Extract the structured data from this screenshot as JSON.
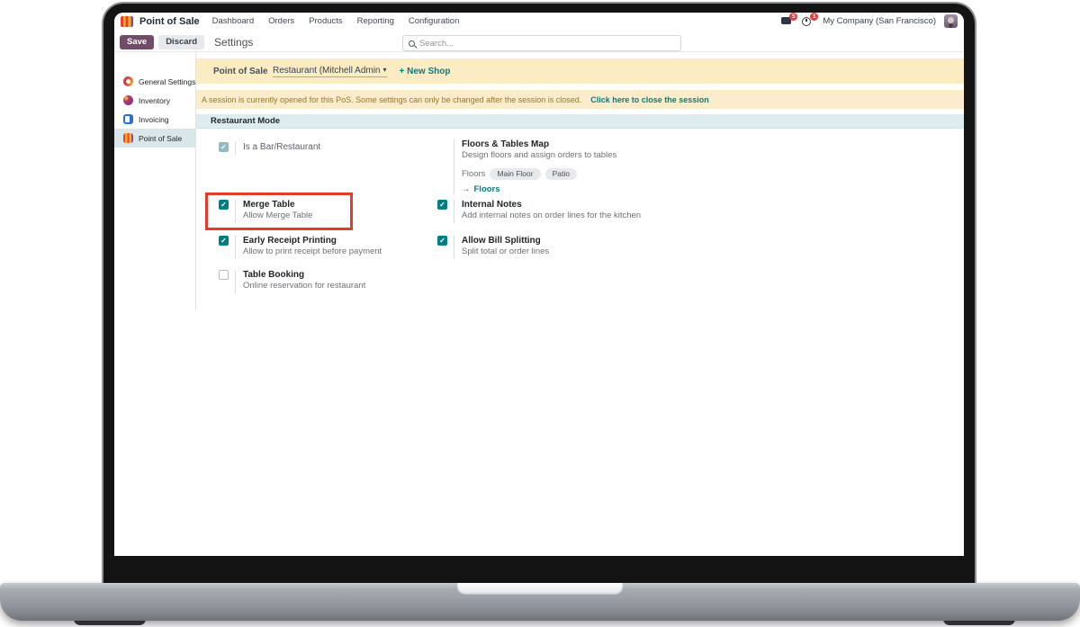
{
  "nav": {
    "app_name": "Point of Sale",
    "menus": [
      "Dashboard",
      "Orders",
      "Products",
      "Reporting",
      "Configuration"
    ],
    "messages_badge": "5",
    "activity_badge": "1",
    "company": "My Company (San Francisco)"
  },
  "control_panel": {
    "save_label": "Save",
    "discard_label": "Discard",
    "title": "Settings",
    "search_placeholder": "Search..."
  },
  "sidebar": {
    "items": [
      {
        "label": "General Settings"
      },
      {
        "label": "Inventory"
      },
      {
        "label": "Invoicing"
      },
      {
        "label": "Point of Sale",
        "active": true
      }
    ]
  },
  "shop_banner": {
    "label": "Point of Sale",
    "shop_value": "Restaurant (Mitchell Admin",
    "new_shop_label": "+ New Shop"
  },
  "session_banner": {
    "message": "A session is currently opened for this PoS. Some settings can only be changed after the session is closed.",
    "link": "Click here to close the session"
  },
  "section": {
    "title": "Restaurant Mode"
  },
  "settings": {
    "left": [
      {
        "title": "Is a Bar/Restaurant",
        "checked": true,
        "muted": true
      },
      {
        "title": "Merge Table",
        "desc": "Allow Merge Table",
        "checked": true,
        "highlighted": true
      },
      {
        "title": "Early Receipt Printing",
        "desc": "Allow to print receipt before payment",
        "checked": true
      },
      {
        "title": "Table Booking",
        "desc": "Online reservation for restaurant",
        "checked": false
      }
    ],
    "right": [
      {
        "title": "Floors & Tables Map",
        "desc": "Design floors and assign orders to tables",
        "floors_label": "Floors",
        "tags": [
          "Main Floor",
          "Patio"
        ],
        "link_label": "Floors"
      },
      {
        "title": "Internal Notes",
        "desc": "Add internal notes on order lines for the kitchen",
        "checked": true
      },
      {
        "title": "Allow Bill Splitting",
        "desc": "Split total or order lines",
        "checked": true
      }
    ]
  },
  "icons": {
    "check": "✓",
    "caret_down": "▾",
    "arrow_right": "→"
  },
  "colors": {
    "accent_teal": "#017e84",
    "primary_button": "#714b67",
    "banner_yellow": "#fcecc4",
    "section_teal": "#ddedef",
    "highlight_red": "#e23c2b",
    "sidebar_active": "#d9e7ea"
  }
}
